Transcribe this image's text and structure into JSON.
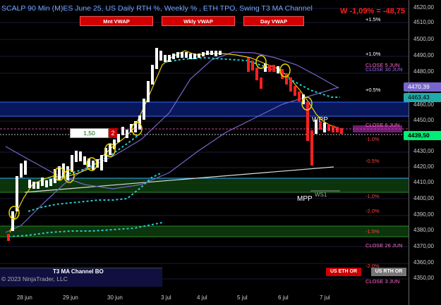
{
  "title": "SCALP 90 Min (M)ES June 25, US Daily RTH %, Weekly % , ETH TPO, Swing T3 MA Channel",
  "pnl": "W -1,09% = -48,75",
  "buttons": {
    "mnt_vwap": "Mnt VWAP",
    "wkly_vwap": "Wkly VWAP",
    "day_vwap": "Day VWAP"
  },
  "pct_levels": [
    "+1.5%",
    "+1.0%",
    "+0.5%",
    "-1.0%",
    "-0.5%",
    "-1.0%",
    "-2.0%",
    "-1.5%",
    "-2.0%"
  ],
  "close_labels": [
    "CLOSE 5 JUN",
    "CLOSE 30 JUN",
    "CLOSE 6 JUN",
    "CLOSE 26 JUN",
    "CLOSE 3 JUN"
  ],
  "y_ticks": [
    "4520,00",
    "4510,00",
    "4500,00",
    "4490,00",
    "4480,00",
    "4460,00",
    "4450,00",
    "4430,00",
    "4420,00",
    "4410,00",
    "4400,00",
    "4390,00",
    "4380,00",
    "4370,00",
    "4360,00",
    "4350,00"
  ],
  "price_labels": {
    "p1": "4470,39",
    "p2": "4463,43",
    "p3": "4439,50"
  },
  "x_ticks": [
    "28 jun",
    "29 jun",
    "30 jun",
    "3 jul",
    "4 jul",
    "5 jul",
    "6 jul",
    "7 jul"
  ],
  "order_entry": {
    "price": "1,50",
    "qty": "2"
  },
  "footer": {
    "t3_label": "T3 MA Channel BO",
    "copyright": "© 2023 NinjaTrader, LLC"
  },
  "session_buttons": {
    "eth": "US ETH OR",
    "rth": "US RTH OR"
  },
  "labels": {
    "wpp": "WPP",
    "mpp": "MPP",
    "ws1": "WS1"
  },
  "chart_data": {
    "type": "candlestick",
    "x_categories": [
      "28 jun",
      "29 jun",
      "30 jun",
      "3 jul",
      "4 jul",
      "5 jul",
      "6 jul",
      "7 jul"
    ],
    "y_range": [
      4350,
      4520
    ],
    "last_price": 4439.5,
    "levels": [
      4470.39,
      4463.43,
      4439.5
    ]
  }
}
